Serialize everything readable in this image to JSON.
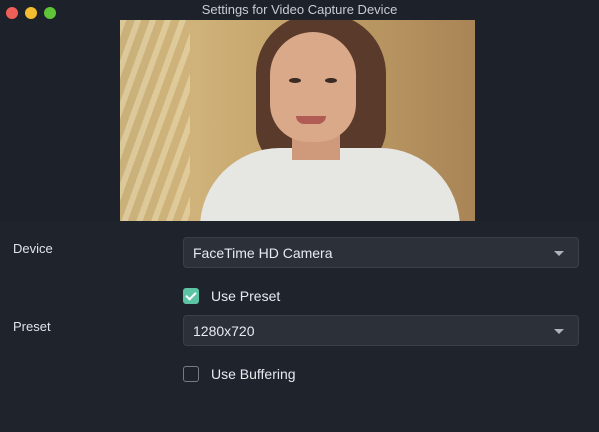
{
  "window": {
    "title": "Settings for Video Capture Device"
  },
  "form": {
    "device": {
      "label": "Device",
      "value": "FaceTime HD Camera"
    },
    "use_preset": {
      "label": "Use Preset",
      "checked": true
    },
    "preset": {
      "label": "Preset",
      "value": "1280x720"
    },
    "use_buffering": {
      "label": "Use Buffering",
      "checked": false
    }
  },
  "colors": {
    "background": "#1f232b",
    "field": "#2b3039",
    "accent": "#5cc4a5"
  }
}
